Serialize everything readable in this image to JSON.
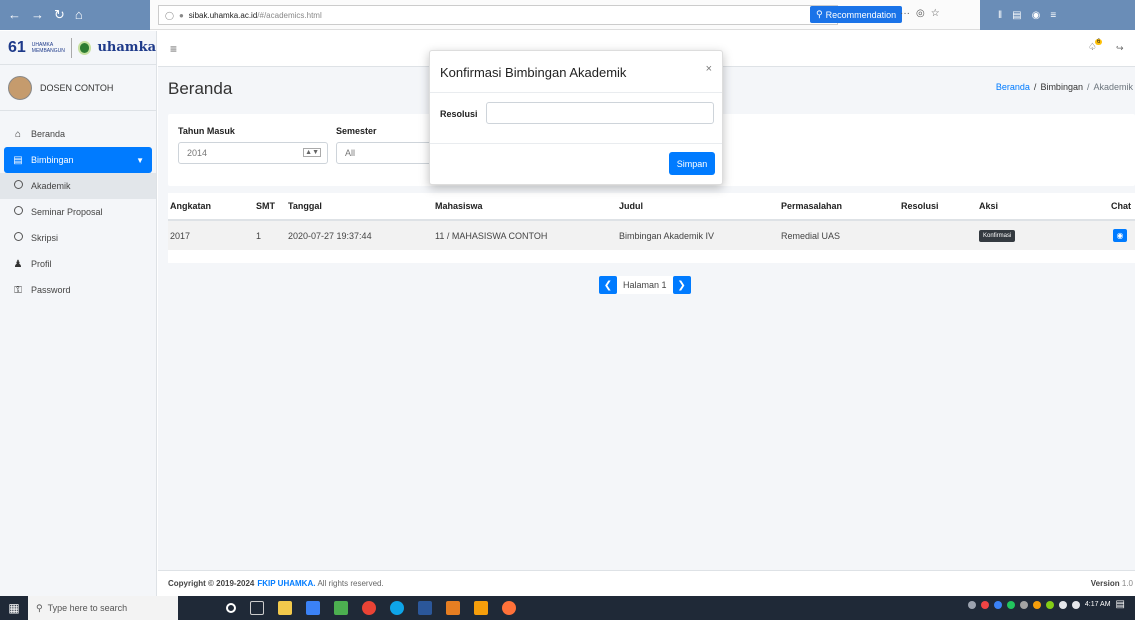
{
  "browser": {
    "url_host": "sibak.uhamka.ac.id",
    "url_path": "/#/academics.html",
    "recommendation_label": "Recommendation",
    "more": "···"
  },
  "brand": {
    "logo_number": "61",
    "logo_caption": "UHAMKA MEMBANGUN",
    "name": "uhamka"
  },
  "user": {
    "name": "DOSEN CONTOH"
  },
  "sidebar": {
    "items": [
      {
        "label": "Beranda",
        "icon": "home-icon"
      },
      {
        "label": "Bimbingan",
        "icon": "book-icon"
      },
      {
        "label": "Akademik",
        "icon": "circle-icon"
      },
      {
        "label": "Seminar Proposal",
        "icon": "circle-icon"
      },
      {
        "label": "Skripsi",
        "icon": "circle-icon"
      },
      {
        "label": "Profil",
        "icon": "user-icon"
      },
      {
        "label": "Password",
        "icon": "key-icon"
      }
    ]
  },
  "header": {
    "page_title": "Beranda",
    "notification_count": "6",
    "breadcrumb": [
      "Beranda",
      "Bimbingan",
      "Akademik"
    ]
  },
  "filters": {
    "tahun_label": "Tahun Masuk",
    "tahun_value": "2014",
    "semester_label": "Semester",
    "semester_value": "All"
  },
  "table": {
    "columns": [
      "Angkatan",
      "SMT",
      "Tanggal",
      "Mahasiswa",
      "Judul",
      "Permasalahan",
      "Resolusi",
      "Aksi",
      "Chat"
    ],
    "rows": [
      {
        "angkatan": "2017",
        "smt": "1",
        "tanggal": "2020-07-27 19:37:44",
        "mahasiswa": "11 / MAHASISWA CONTOH",
        "judul": "Bimbingan Akademik IV",
        "permasalahan": "Remedial UAS",
        "resolusi": "",
        "aksi_label": "Konfirmasi"
      }
    ]
  },
  "pagination": {
    "label": "Halaman 1"
  },
  "modal": {
    "title": "Konfirmasi Bimbingan Akademik",
    "field_label": "Resolusi",
    "field_value": "",
    "submit_label": "Simpan",
    "close": "×"
  },
  "footer": {
    "copyright_prefix": "Copyright © 2019-2024 ",
    "org": "FKIP UHAMKA.",
    "rights": " All rights reserved.",
    "version_label": "Version",
    "version_value": "1.0"
  },
  "taskbar": {
    "search_placeholder": "Type here to search",
    "time": "4:17 AM"
  },
  "colors": {
    "primary": "#007bff",
    "dark": "#343a40",
    "sidebar_bg": "#f4f6f9"
  }
}
